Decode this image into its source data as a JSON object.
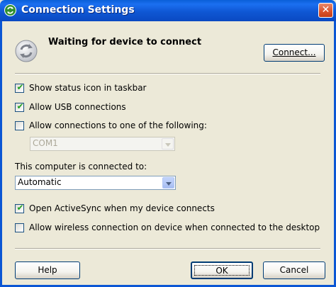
{
  "window": {
    "title": "Connection Settings",
    "close_glyph": "✕"
  },
  "status": {
    "text": "Waiting for device to connect",
    "icon": "sync-icon"
  },
  "buttons": {
    "connect": "Connect...",
    "help": "Help",
    "ok": "OK",
    "cancel": "Cancel"
  },
  "options": {
    "show_status_icon": {
      "label": "Show status icon in taskbar",
      "checked": true
    },
    "allow_usb": {
      "label": "Allow USB connections",
      "checked": true
    },
    "allow_port": {
      "label": "Allow connections to one of the following:",
      "checked": false
    },
    "open_activesync": {
      "label": "Open ActiveSync when my device connects",
      "checked": true
    },
    "allow_wireless": {
      "label": "Allow wireless connection on device when connected to the desktop",
      "checked": false
    }
  },
  "port_select": {
    "value": "COM1",
    "enabled": false
  },
  "connected_to": {
    "label": "This computer is connected to:",
    "value": "Automatic"
  },
  "colors": {
    "titlebar": "#0a5fd8",
    "checkmark": "#21a121",
    "close": "#d9512b"
  }
}
